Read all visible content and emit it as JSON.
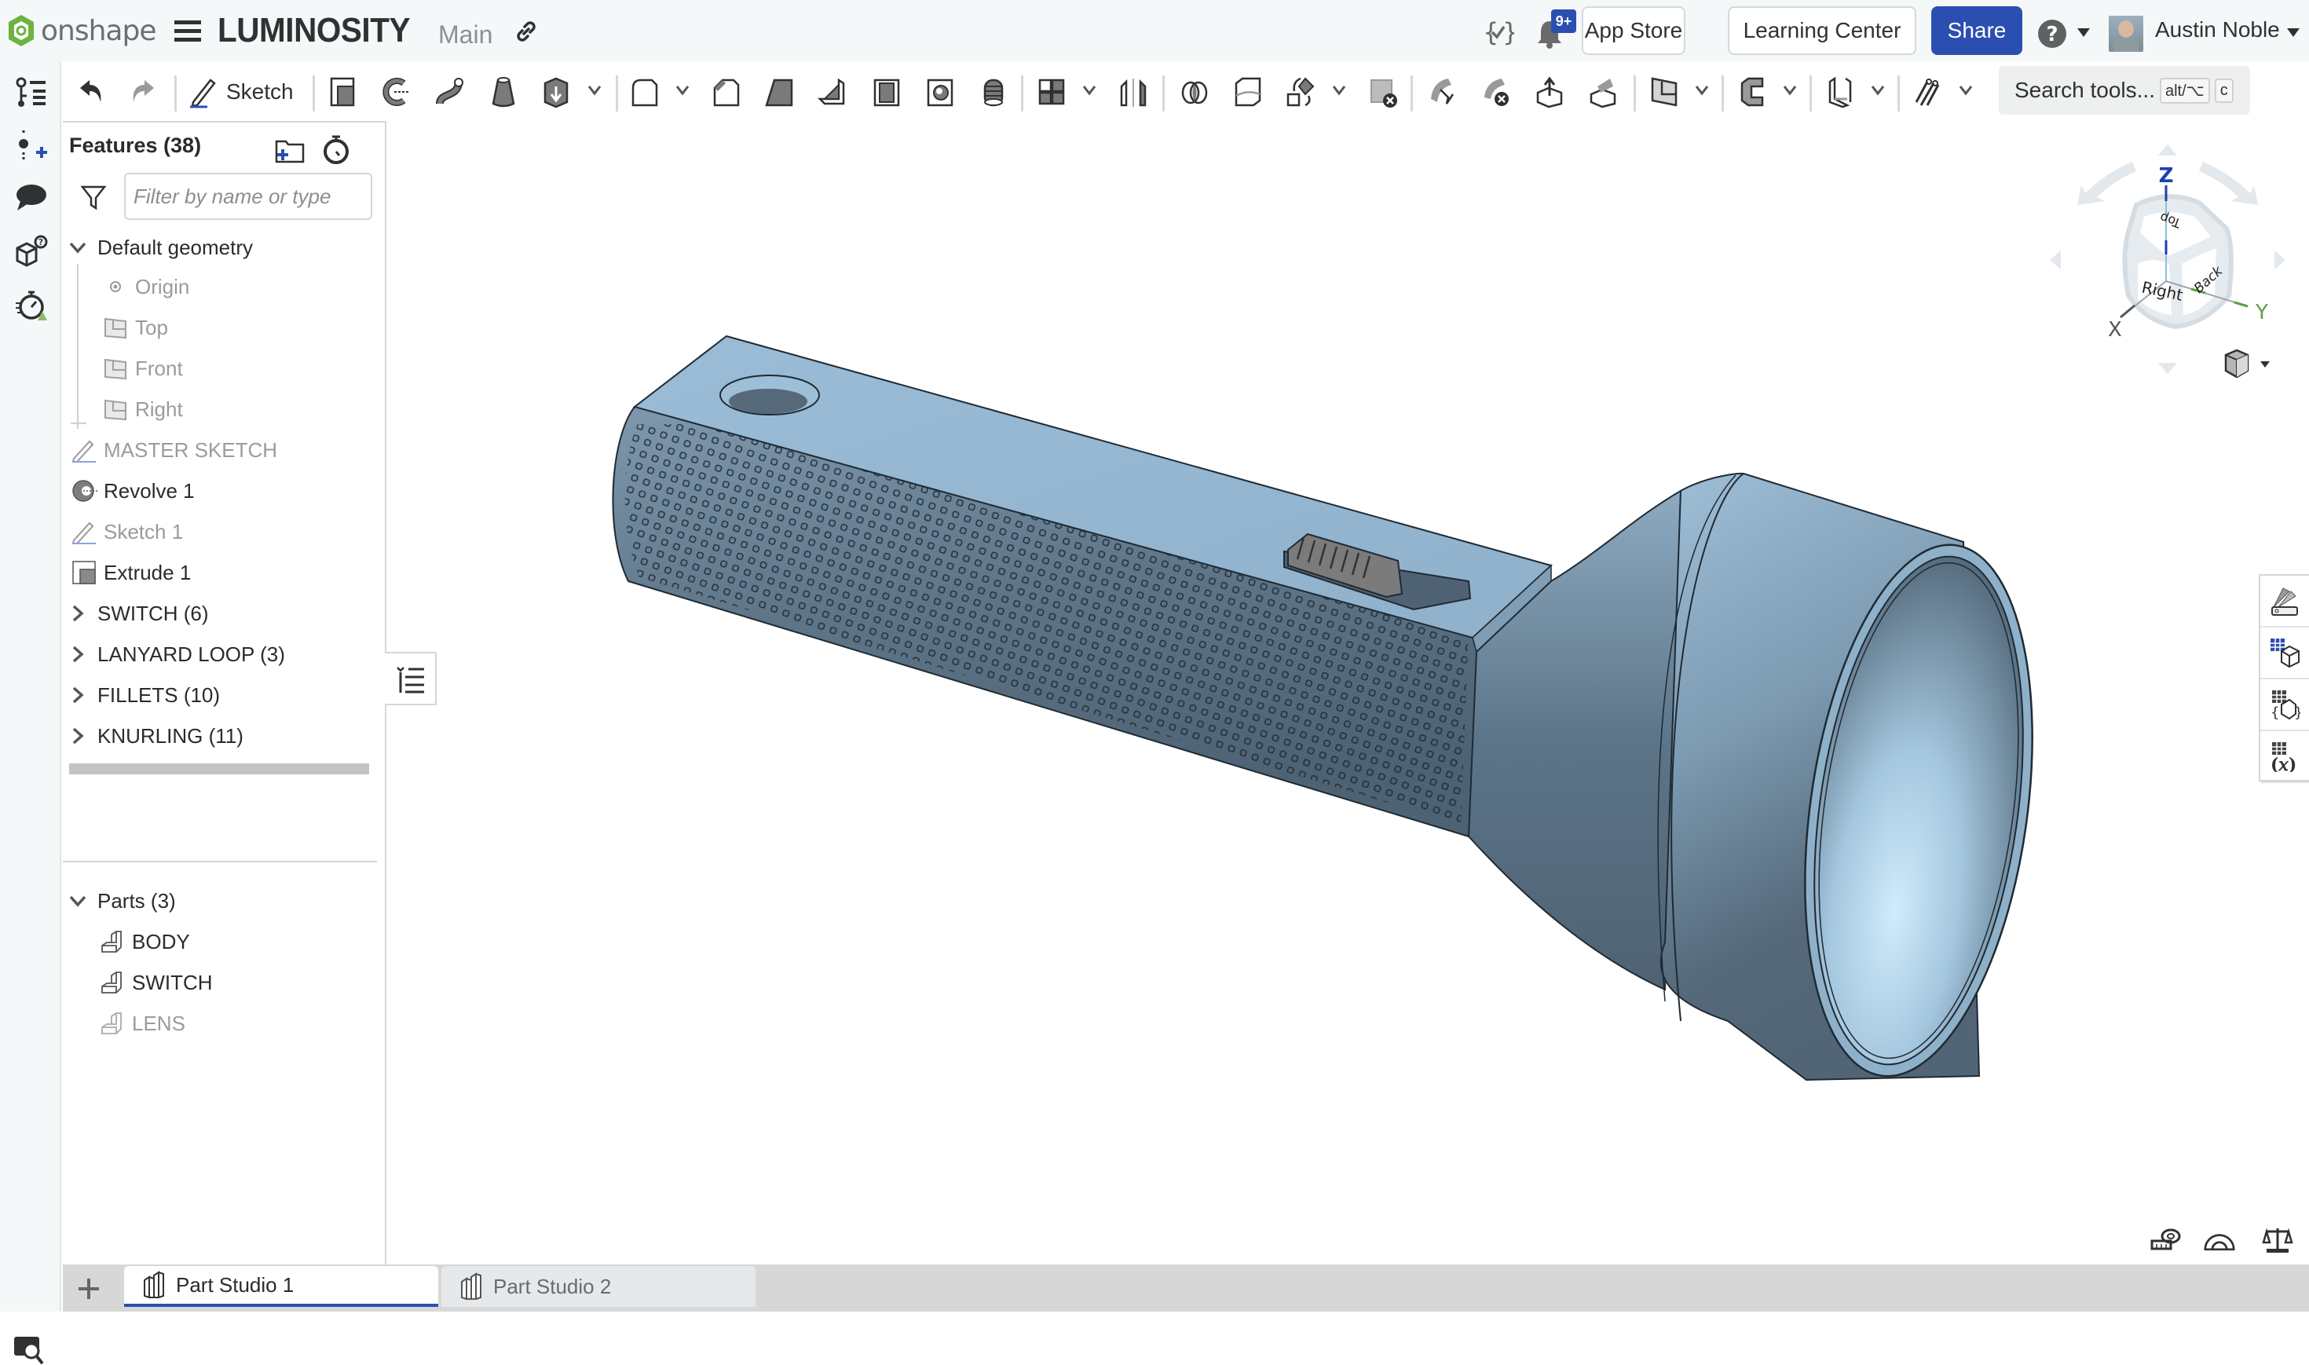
{
  "header": {
    "brand": "onshape",
    "document_title": "LUMINOSITY",
    "branch": "Main",
    "notifications_badge": "9+",
    "app_store_label": "App Store",
    "learning_center_label": "Learning Center",
    "share_label": "Share",
    "user_name": "Austin Noble",
    "icons": [
      "menu-icon",
      "link-icon",
      "variable-check-icon",
      "bell-icon",
      "help-icon",
      "avatar"
    ],
    "accent_color": "#2b4fb0"
  },
  "toolbar": {
    "sketch_label": "Sketch",
    "search_placeholder": "Search tools...",
    "search_shortcut_mod": "alt/⌥",
    "search_shortcut_key": "c",
    "tools": [
      "undo",
      "redo",
      "sketch",
      "extrude",
      "revolve",
      "sweep",
      "loft",
      "thicken",
      "fillet",
      "chamfer",
      "draft",
      "rib",
      "shell",
      "hole",
      "thread",
      "pattern",
      "mirror",
      "boolean",
      "split",
      "transform",
      "delete-part",
      "modify-fillet",
      "delete-face",
      "move-face",
      "replace-face",
      "plane",
      "sheet-metal",
      "frame",
      "helix"
    ]
  },
  "rail": {
    "items": [
      "feature-list",
      "insert-mate-connector",
      "comments",
      "parts-help",
      "performance-check"
    ]
  },
  "features_panel": {
    "title": "Features (38)",
    "filter_placeholder": "Filter by name or type",
    "default_geometry": {
      "label": "Default geometry",
      "expanded": true,
      "items": [
        {
          "label": "Origin",
          "icon": "origin"
        },
        {
          "label": "Top",
          "icon": "plane"
        },
        {
          "label": "Front",
          "icon": "plane"
        },
        {
          "label": "Right",
          "icon": "plane"
        }
      ]
    },
    "features": [
      {
        "label": "MASTER SKETCH",
        "icon": "sketch",
        "dim": true
      },
      {
        "label": "Revolve 1",
        "icon": "revolve",
        "dim": false
      },
      {
        "label": "Sketch 1",
        "icon": "sketch",
        "dim": true
      },
      {
        "label": "Extrude 1",
        "icon": "extrude",
        "dim": false
      }
    ],
    "folders": [
      {
        "label": "SWITCH (6)"
      },
      {
        "label": "LANYARD LOOP (3)"
      },
      {
        "label": "FILLETS (10)"
      },
      {
        "label": "KNURLING (11)"
      }
    ],
    "parts": {
      "label": "Parts (3)",
      "expanded": true,
      "items": [
        {
          "label": "BODY",
          "dim": false
        },
        {
          "label": "SWITCH",
          "dim": false
        },
        {
          "label": "LENS",
          "dim": true
        }
      ]
    }
  },
  "viewcube": {
    "faces": [
      "Top",
      "Right",
      "Back"
    ],
    "axes": [
      "X",
      "Y",
      "Z"
    ]
  },
  "model": {
    "description": "Flashlight body with knurled handle, lanyard hole, slide switch and flared head",
    "color": "#8fb3cf"
  },
  "tabs": [
    {
      "label": "Part Studio 1",
      "active": true
    },
    {
      "label": "Part Studio 2",
      "active": false
    }
  ]
}
